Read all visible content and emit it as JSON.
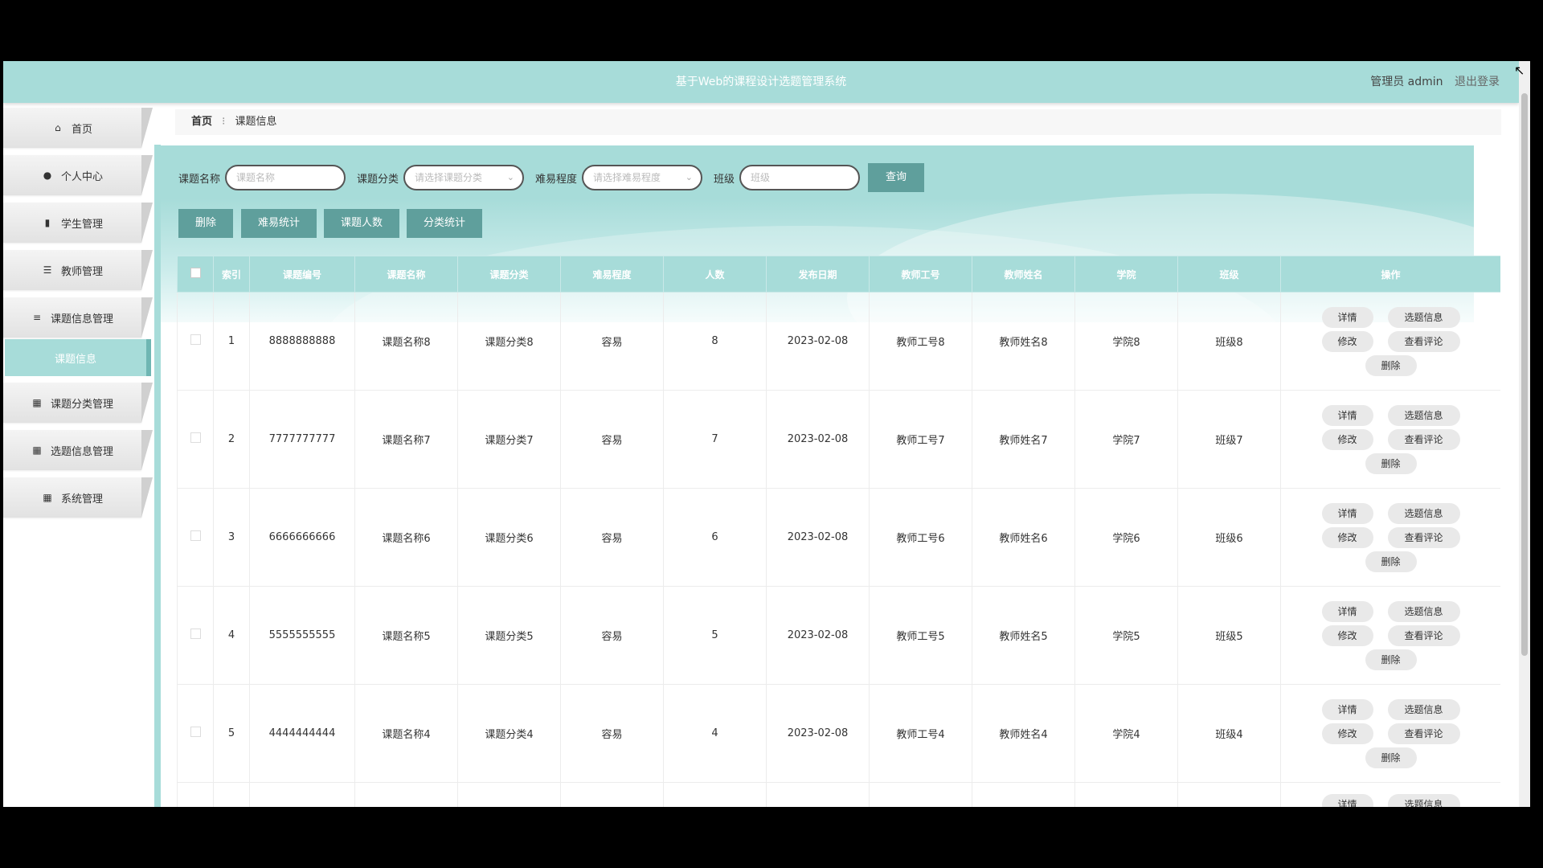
{
  "header": {
    "title": "基于Web的课程设计选题管理系统",
    "user_label": "管理员 admin",
    "logout": "退出登录"
  },
  "sidebar": {
    "items": [
      {
        "label": "首页",
        "icon": "home-icon"
      },
      {
        "label": "个人中心",
        "icon": "user-icon"
      },
      {
        "label": "学生管理",
        "icon": "clipboard-icon"
      },
      {
        "label": "教师管理",
        "icon": "list-icon"
      },
      {
        "label": "课题信息管理",
        "icon": "sliders-icon"
      },
      {
        "label": "课题分类管理",
        "icon": "grid-icon"
      },
      {
        "label": "选题信息管理",
        "icon": "grid-icon"
      },
      {
        "label": "系统管理",
        "icon": "grid-icon"
      }
    ],
    "active_sub": "课题信息"
  },
  "breadcrumb": {
    "home": "首页",
    "separator": "⁝",
    "current": "课题信息"
  },
  "search": {
    "name_label": "课题名称",
    "name_placeholder": "课题名称",
    "category_label": "课题分类",
    "category_placeholder": "请选择课题分类",
    "difficulty_label": "难易程度",
    "difficulty_placeholder": "请选择难易程度",
    "class_label": "班级",
    "class_placeholder": "班级",
    "query": "查询"
  },
  "actions": {
    "delete": "删除",
    "difficulty_stats": "难易统计",
    "topic_count": "课题人数",
    "category_stats": "分类统计"
  },
  "table": {
    "headers": [
      "",
      "索引",
      "课题编号",
      "课题名称",
      "课题分类",
      "难易程度",
      "人数",
      "发布日期",
      "教师工号",
      "教师姓名",
      "学院",
      "班级",
      "操作"
    ],
    "rows": [
      [
        "1",
        "8888888888",
        "课题名称8",
        "课题分类8",
        "容易",
        "8",
        "2023-02-08",
        "教师工号8",
        "教师姓名8",
        "学院8",
        "班级8"
      ],
      [
        "2",
        "7777777777",
        "课题名称7",
        "课题分类7",
        "容易",
        "7",
        "2023-02-08",
        "教师工号7",
        "教师姓名7",
        "学院7",
        "班级7"
      ],
      [
        "3",
        "6666666666",
        "课题名称6",
        "课题分类6",
        "容易",
        "6",
        "2023-02-08",
        "教师工号6",
        "教师姓名6",
        "学院6",
        "班级6"
      ],
      [
        "4",
        "5555555555",
        "课题名称5",
        "课题分类5",
        "容易",
        "5",
        "2023-02-08",
        "教师工号5",
        "教师姓名5",
        "学院5",
        "班级5"
      ],
      [
        "5",
        "4444444444",
        "课题名称4",
        "课题分类4",
        "容易",
        "4",
        "2023-02-08",
        "教师工号4",
        "教师姓名4",
        "学院4",
        "班级4"
      ]
    ],
    "row_ops": {
      "detail": "详情",
      "select_info": "选题信息",
      "edit": "修改",
      "view_comments": "查看评论",
      "delete": "删除"
    },
    "partial_row_ops": {
      "detail": "详情",
      "select_info": "选题信息"
    }
  },
  "colors": {
    "header_teal": "#a7dcd9",
    "button_teal": "#5f9f9c"
  }
}
